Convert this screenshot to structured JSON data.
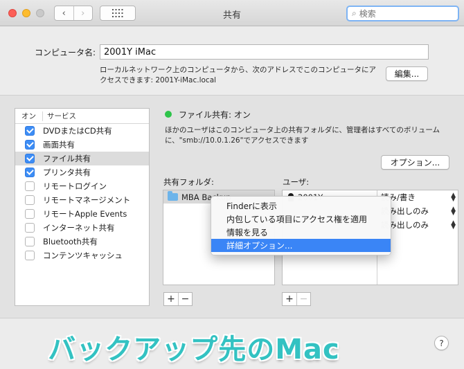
{
  "window": {
    "title": "共有",
    "search_placeholder": "検索",
    "back_icon": "‹",
    "forward_icon": "›"
  },
  "computer_name": {
    "label": "コンピュータ名:",
    "value": "2001Y iMac",
    "description": "ローカルネットワーク上のコンピュータから、次のアドレスでこのコンピュータにアクセスできます: 2001Y-iMac.local",
    "edit_button": "編集..."
  },
  "services": {
    "header_on": "オン",
    "header_service": "サービス",
    "items": [
      {
        "label": "DVDまたはCD共有",
        "checked": true,
        "selected": false
      },
      {
        "label": "画面共有",
        "checked": true,
        "selected": false
      },
      {
        "label": "ファイル共有",
        "checked": true,
        "selected": true
      },
      {
        "label": "プリンタ共有",
        "checked": true,
        "selected": false
      },
      {
        "label": "リモートログイン",
        "checked": false,
        "selected": false
      },
      {
        "label": "リモートマネージメント",
        "checked": false,
        "selected": false
      },
      {
        "label": "リモートApple Events",
        "checked": false,
        "selected": false
      },
      {
        "label": "インターネット共有",
        "checked": false,
        "selected": false
      },
      {
        "label": "Bluetooth共有",
        "checked": false,
        "selected": false
      },
      {
        "label": "コンテンツキャッシュ",
        "checked": false,
        "selected": false
      }
    ]
  },
  "file_sharing": {
    "status": "ファイル共有: オン",
    "status_color": "#2ec44a",
    "description": "ほかのユーザはこのコンピュータ上の共有フォルダに、管理者はすべてのボリュームに、\"smb://10.0.1.26\"でアクセスできます",
    "options_button": "オプション...",
    "shared_folders_label": "共有フォルダ:",
    "users_label": "ユーザ:",
    "folders": [
      "MBA Backup"
    ],
    "users": [
      "2001Y"
    ],
    "permissions": [
      "読み/書き",
      "読み出しのみ",
      "読み出しのみ"
    ],
    "plus": "+",
    "minus": "−"
  },
  "context_menu": {
    "items": [
      {
        "label": "Finderに表示",
        "highlighted": false
      },
      {
        "label": "内包している項目にアクセス権を適用",
        "highlighted": false
      },
      {
        "label": "情報を見る",
        "highlighted": false
      },
      {
        "label": "詳細オプション...",
        "highlighted": true
      }
    ],
    "highlight_color": "#3a85f6"
  },
  "caption": "バックアップ先のMac",
  "caption_color": "#33c2c2",
  "help": "?"
}
